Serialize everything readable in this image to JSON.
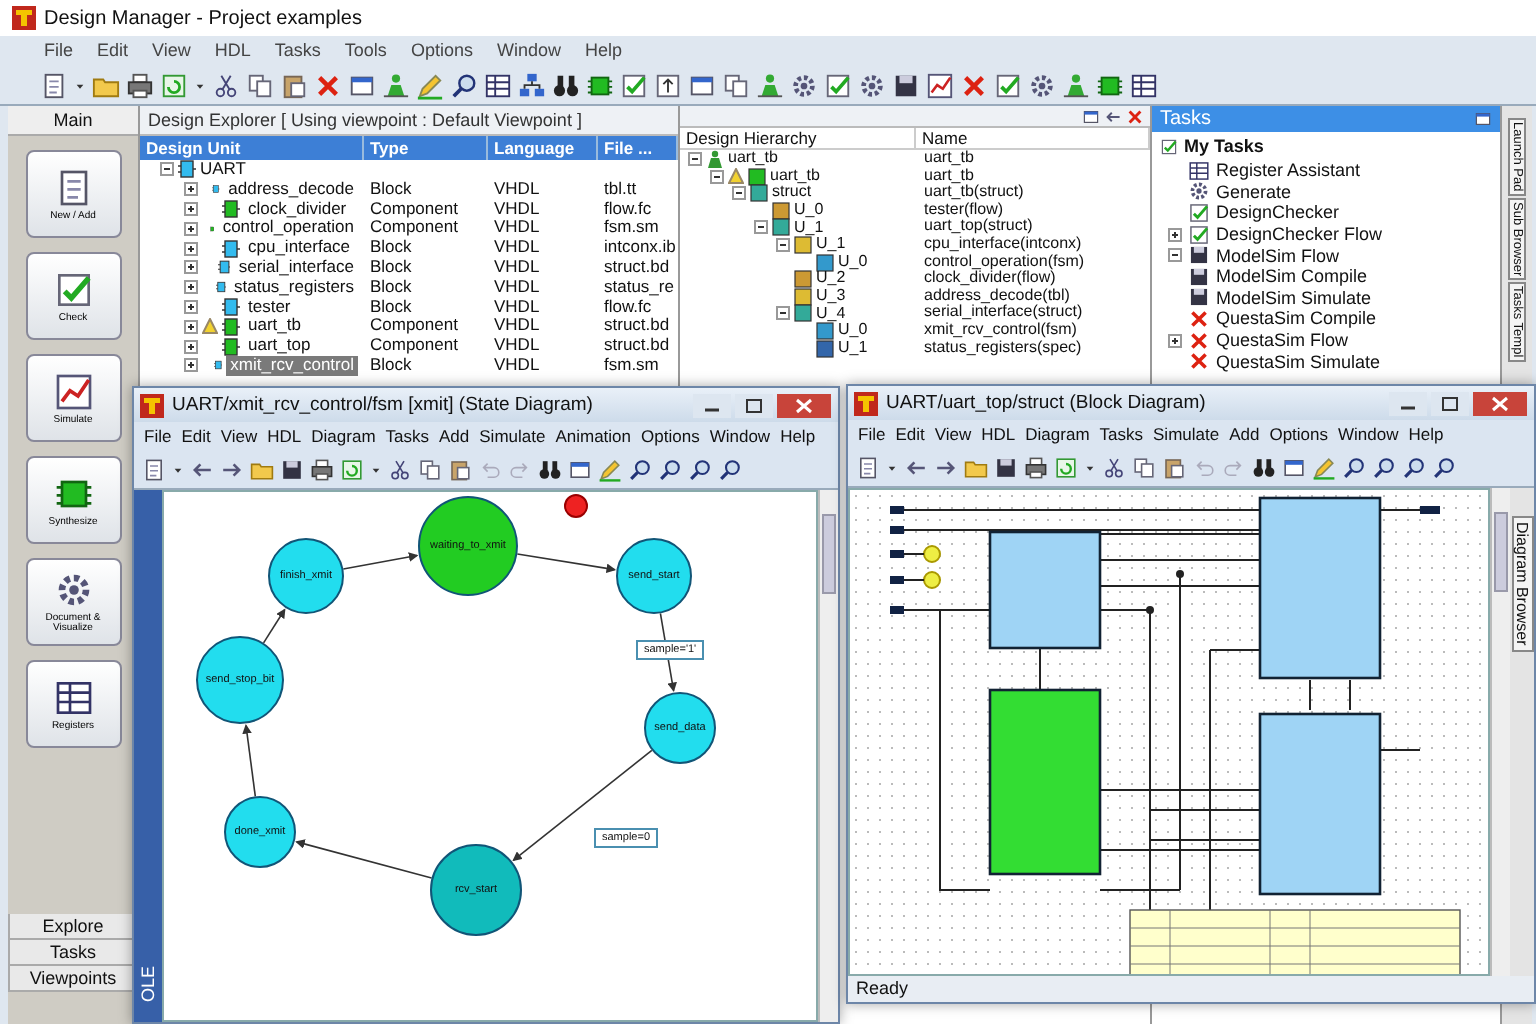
{
  "window": {
    "title": "Design Manager - Project examples"
  },
  "menu": [
    "File",
    "Edit",
    "View",
    "HDL",
    "Tasks",
    "Tools",
    "Options",
    "Window",
    "Help"
  ],
  "sidebar": {
    "title": "Main",
    "items": [
      {
        "label": "New / Add",
        "kind": "new"
      },
      {
        "label": "Check",
        "kind": "check"
      },
      {
        "label": "Simulate",
        "kind": "simulate"
      },
      {
        "label": "Synthesize",
        "kind": "synthesize"
      },
      {
        "label": "Document & Visualize",
        "kind": "document"
      },
      {
        "label": "Registers",
        "kind": "registers"
      }
    ],
    "tabs": [
      "Explore",
      "Tasks",
      "Viewpoints"
    ]
  },
  "explorer": {
    "title": "Design Explorer [ Using viewpoint : Default Viewpoint ]",
    "columns": [
      "Design Unit",
      "Type",
      "Language",
      "File ..."
    ],
    "root": "UART",
    "rows": [
      {
        "name": "address_decode",
        "type": "Block",
        "language": "VHDL",
        "file": "tbl.tt",
        "kind": "block",
        "warning": false,
        "selected": false
      },
      {
        "name": "clock_divider",
        "type": "Component",
        "language": "VHDL",
        "file": "flow.fc",
        "kind": "component",
        "warning": false,
        "selected": false
      },
      {
        "name": "control_operation",
        "type": "Component",
        "language": "VHDL",
        "file": "fsm.sm",
        "kind": "component",
        "warning": false,
        "selected": false
      },
      {
        "name": "cpu_interface",
        "type": "Block",
        "language": "VHDL",
        "file": "intconx.ib",
        "kind": "block",
        "warning": false,
        "selected": false
      },
      {
        "name": "serial_interface",
        "type": "Block",
        "language": "VHDL",
        "file": "struct.bd",
        "kind": "block",
        "warning": false,
        "selected": false
      },
      {
        "name": "status_registers",
        "type": "Block",
        "language": "VHDL",
        "file": "status_re",
        "kind": "block",
        "warning": false,
        "selected": false
      },
      {
        "name": "tester",
        "type": "Block",
        "language": "VHDL",
        "file": "flow.fc",
        "kind": "block",
        "warning": false,
        "selected": false
      },
      {
        "name": "uart_tb",
        "type": "Component",
        "language": "VHDL",
        "file": "struct.bd",
        "kind": "component",
        "warning": true,
        "selected": false
      },
      {
        "name": "uart_top",
        "type": "Component",
        "language": "VHDL",
        "file": "struct.bd",
        "kind": "component",
        "warning": false,
        "selected": false
      },
      {
        "name": "xmit_rcv_control",
        "type": "Block",
        "language": "VHDL",
        "file": "fsm.sm",
        "kind": "block",
        "warning": false,
        "selected": true
      }
    ]
  },
  "hierarchy": {
    "columns": [
      "Design Hierarchy",
      "Name"
    ],
    "tree": [
      {
        "label": "uart_tb",
        "name": "uart_tb",
        "kind": "testbench",
        "warning": false,
        "children": [
          {
            "label": "uart_tb",
            "name": "uart_tb",
            "kind": "component",
            "warning": true,
            "children": [
              {
                "label": "struct",
                "name": "uart_tb(struct)",
                "kind": "struct",
                "warning": false,
                "children": [
                  {
                    "label": "U_0",
                    "name": "tester(flow)",
                    "kind": "flow",
                    "warning": false
                  },
                  {
                    "label": "U_1",
                    "name": "uart_top(struct)",
                    "kind": "struct",
                    "warning": false,
                    "children": [
                      {
                        "label": "U_1",
                        "name": "cpu_interface(intconx)",
                        "kind": "table",
                        "warning": false,
                        "children": [
                          {
                            "label": "U_0",
                            "name": "control_operation(fsm)",
                            "kind": "fsm",
                            "warning": false
                          }
                        ]
                      },
                      {
                        "label": "U_2",
                        "name": "clock_divider(flow)",
                        "kind": "flow",
                        "warning": false
                      },
                      {
                        "label": "U_3",
                        "name": "address_decode(tbl)",
                        "kind": "table",
                        "warning": false
                      },
                      {
                        "label": "U_4",
                        "name": "serial_interface(struct)",
                        "kind": "struct",
                        "warning": false,
                        "children": [
                          {
                            "label": "U_0",
                            "name": "xmit_rcv_control(fsm)",
                            "kind": "fsm",
                            "warning": false
                          },
                          {
                            "label": "U_1",
                            "name": "status_registers(spec)",
                            "kind": "spec",
                            "warning": false
                          }
                        ]
                      }
                    ]
                  }
                ]
              }
            ]
          }
        ]
      }
    ]
  },
  "tasks": {
    "title": "Tasks",
    "root": "My Tasks",
    "items": [
      {
        "label": "Register Assistant",
        "kind": "register"
      },
      {
        "label": "Generate",
        "kind": "generate"
      },
      {
        "label": "DesignChecker",
        "kind": "checker"
      },
      {
        "label": "DesignChecker Flow",
        "kind": "checker",
        "expanded": false
      },
      {
        "label": "ModelSim Flow",
        "kind": "modelsim",
        "expanded": true
      },
      {
        "label": "ModelSim Compile",
        "kind": "modelsim"
      },
      {
        "label": "ModelSim Simulate",
        "kind": "modelsim"
      },
      {
        "label": "QuestaSim Compile",
        "kind": "questa"
      },
      {
        "label": "QuestaSim Flow",
        "kind": "questa",
        "expanded": false
      },
      {
        "label": "QuestaSim Simulate",
        "kind": "questa"
      }
    ],
    "side_tabs": [
      "Launch Pad",
      "Sub Browser",
      "Tasks Templ"
    ]
  },
  "state_window": {
    "title": "UART/xmit_rcv_control/fsm [xmit] (State Diagram)",
    "menu": [
      "File",
      "Edit",
      "View",
      "HDL",
      "Diagram",
      "Tasks",
      "Add",
      "Simulate",
      "Animation",
      "Options",
      "Window",
      "Help"
    ],
    "side_label": "OLE",
    "states": [
      {
        "name": "waiting_to_xmit",
        "color": "#22cc22"
      },
      {
        "name": "finish_xmit",
        "color": "#22ddee"
      },
      {
        "name": "send_start",
        "color": "#22ddee"
      },
      {
        "name": "send_stop_bit",
        "color": "#22ddee"
      },
      {
        "name": "send_data",
        "color": "#22ddee"
      },
      {
        "name": "done_xmit",
        "color": "#22ddee"
      },
      {
        "name": "rcv_start",
        "color": "#11bbbb"
      }
    ],
    "labels": [
      "sample='1'",
      "sample=0"
    ]
  },
  "block_window": {
    "title": "UART/uart_top/struct (Block Diagram)",
    "menu": [
      "File",
      "Edit",
      "View",
      "HDL",
      "Diagram",
      "Tasks",
      "Simulate",
      "Add",
      "Options",
      "Window",
      "Help"
    ],
    "side_tab": "Diagram Browser",
    "status": "Ready"
  }
}
